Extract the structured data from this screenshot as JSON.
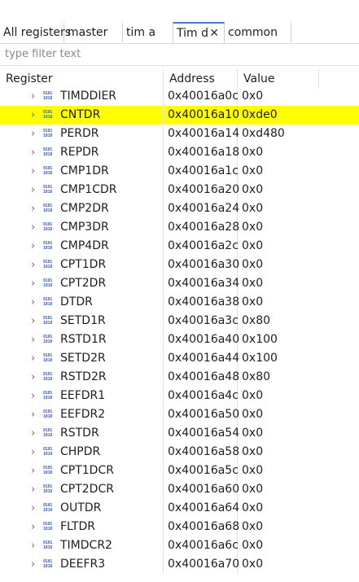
{
  "tabs": [
    {
      "label": "All registers"
    },
    {
      "label": "master"
    },
    {
      "label": "tim a"
    },
    {
      "label": "Tim d",
      "close": "✕"
    },
    {
      "label": "common"
    }
  ],
  "filter": {
    "placeholder": "type filter text"
  },
  "table": {
    "headers": {
      "register": "Register",
      "address": "Address",
      "value": "Value"
    },
    "selected_color": "#ffff00",
    "icon": "binary-register-icon",
    "rows": [
      {
        "name": "TIMDDIER",
        "address": "0x40016a0c",
        "value": "0x0"
      },
      {
        "name": "CNTDR",
        "address": "0x40016a10",
        "value": "0xde0",
        "selected": true
      },
      {
        "name": "PERDR",
        "address": "0x40016a14",
        "value": "0xd480"
      },
      {
        "name": "REPDR",
        "address": "0x40016a18",
        "value": "0x0"
      },
      {
        "name": "CMP1DR",
        "address": "0x40016a1c",
        "value": "0x0"
      },
      {
        "name": "CMP1CDR",
        "address": "0x40016a20",
        "value": "0x0"
      },
      {
        "name": "CMP2DR",
        "address": "0x40016a24",
        "value": "0x0"
      },
      {
        "name": "CMP3DR",
        "address": "0x40016a28",
        "value": "0x0"
      },
      {
        "name": "CMP4DR",
        "address": "0x40016a2c",
        "value": "0x0"
      },
      {
        "name": "CPT1DR",
        "address": "0x40016a30",
        "value": "0x0"
      },
      {
        "name": "CPT2DR",
        "address": "0x40016a34",
        "value": "0x0"
      },
      {
        "name": "DTDR",
        "address": "0x40016a38",
        "value": "0x0"
      },
      {
        "name": "SETD1R",
        "address": "0x40016a3c",
        "value": "0x80"
      },
      {
        "name": "RSTD1R",
        "address": "0x40016a40",
        "value": "0x100"
      },
      {
        "name": "SETD2R",
        "address": "0x40016a44",
        "value": "0x100"
      },
      {
        "name": "RSTD2R",
        "address": "0x40016a48",
        "value": "0x80"
      },
      {
        "name": "EEFDR1",
        "address": "0x40016a4c",
        "value": "0x0"
      },
      {
        "name": "EEFDR2",
        "address": "0x40016a50",
        "value": "0x0"
      },
      {
        "name": "RSTDR",
        "address": "0x40016a54",
        "value": "0x0"
      },
      {
        "name": "CHPDR",
        "address": "0x40016a58",
        "value": "0x0"
      },
      {
        "name": "CPT1DCR",
        "address": "0x40016a5c",
        "value": "0x0"
      },
      {
        "name": "CPT2DCR",
        "address": "0x40016a60",
        "value": "0x0"
      },
      {
        "name": "OUTDR",
        "address": "0x40016a64",
        "value": "0x0"
      },
      {
        "name": "FLTDR",
        "address": "0x40016a68",
        "value": "0x0"
      },
      {
        "name": "TIMDCR2",
        "address": "0x40016a6c",
        "value": "0x0"
      },
      {
        "name": "DEEFR3",
        "address": "0x40016a70",
        "value": "0x0"
      }
    ]
  }
}
